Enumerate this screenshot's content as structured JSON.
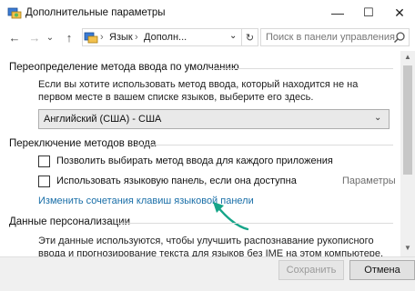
{
  "window": {
    "title": "Дополнительные параметры",
    "minimize_glyph": "—",
    "maximize_glyph": "☐",
    "close_glyph": "✕"
  },
  "nav": {
    "back_glyph": "←",
    "forward_glyph": "→",
    "history_glyph": "⌄",
    "up_glyph": "↑",
    "breadcrumb": [
      "Язык",
      "Дополн..."
    ],
    "separator": "›",
    "dropdown_glyph": "⌄",
    "refresh_glyph": "↻",
    "search_placeholder": "Поиск в панели управления"
  },
  "override": {
    "title": "Переопределение метода ввода по умолчанию",
    "description": "Если вы хотите использовать метод ввода, который находится не на первом месте в вашем списке языков, выберите его здесь.",
    "selected": "Английский (США) - США"
  },
  "switching": {
    "title": "Переключение методов ввода",
    "option1": {
      "label": "Позволить выбирать метод ввода для каждого приложения",
      "checked": false
    },
    "option2": {
      "label": "Использовать языковую панель, если она доступна",
      "checked": false
    },
    "params_link": "Параметры",
    "hotkeys_link": "Изменить сочетания клавиш языковой панели"
  },
  "personal": {
    "title": "Данные персонализации",
    "description": "Эти данные используются, чтобы улучшить распознавание рукописного ввода и прогнозирование текста для языков без IME на этом компьютере. Никакие"
  },
  "footer": {
    "save": "Сохранить",
    "cancel": "Отмена"
  },
  "colors": {
    "link": "#1a6fa8",
    "annotation_arrow": "#17a589"
  }
}
